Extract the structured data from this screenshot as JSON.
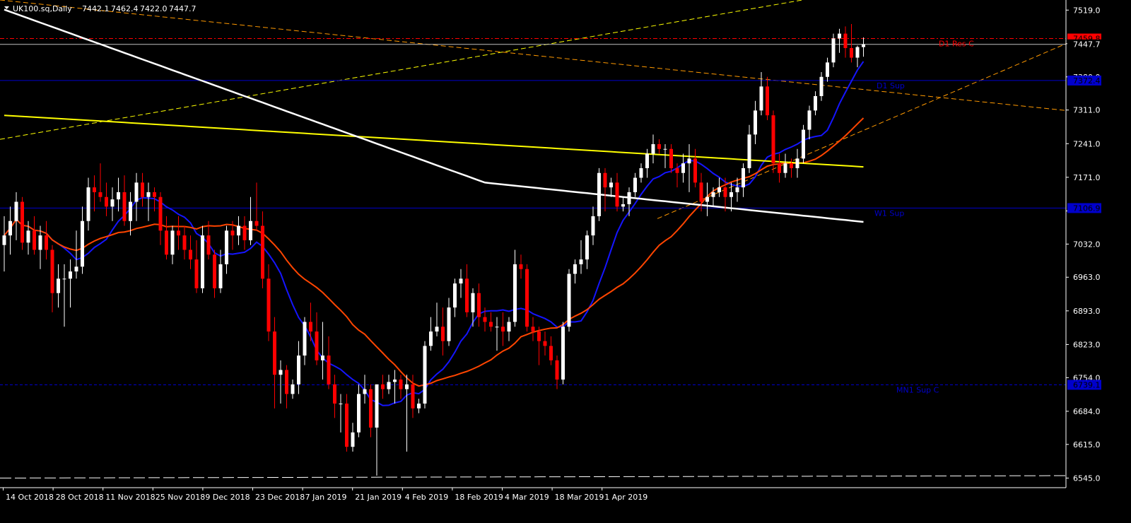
{
  "chart_data": {
    "type": "candlestick",
    "title": "UK100.sq,Daily",
    "ohlc_header": [
      "7442.1",
      "7462.4",
      "7422.0",
      "7447.7"
    ],
    "ylim": [
      6525,
      7540
    ],
    "y_ticks": [
      7519.0,
      7449.0,
      7380.0,
      7311.0,
      7241.0,
      7171.0,
      7101.0,
      7032.0,
      6963.0,
      6893.0,
      6823.0,
      6754.0,
      6684.0,
      6615.0,
      6545.0
    ],
    "y_tick_labels": [
      "7519.0",
      "",
      "7380.0",
      "7311.0",
      "7241.0",
      "7171.0",
      "",
      "7032.0",
      "6963.0",
      "6893.0",
      "6823.0",
      "6754.0",
      "6684.0",
      "6615.0",
      "6545.0"
    ],
    "x_tick_labels": [
      "14 Oct 2018",
      "28 Oct 2018",
      "11 Nov 2018",
      "25 Nov 2018",
      "9 Dec 2018",
      "23 Dec 2018",
      "7 Jan 2019",
      "21 Jan 2019",
      "4 Feb 2019",
      "18 Feb 2019",
      "4 Mar 2019",
      "18 Mar 2019",
      "1 Apr 2019"
    ],
    "grid": false,
    "colors": {
      "background": "#000000",
      "bull": "#ffffff",
      "bear": "#ff0000",
      "axis_text": "#ffffff",
      "ma_fast": "#1515ff",
      "ma_mid": "#ff4500",
      "ma_slow_yellow": "#ffff00",
      "ma_slow_white": "#ffffff",
      "level_blue": "#0000cc",
      "level_red": "#ff0000",
      "trend_orange": "#ff9900",
      "trend_yellow": "#ffff00"
    },
    "levels": [
      {
        "name": "D1 Res C",
        "price": 7459.8,
        "label": "7459.8",
        "style": "dashdot",
        "color": "#ff0000"
      },
      {
        "name": "current",
        "price": 7447.7,
        "label": "7447.7",
        "style": "solid",
        "color": "#c0c0c0"
      },
      {
        "name": "D1 Sup",
        "price": 7372.4,
        "label": "7372.4",
        "style": "solid",
        "color": "#0000cc"
      },
      {
        "name": "W1 Sup",
        "price": 7106.9,
        "label": "7106.9",
        "style": "solid",
        "color": "#0000cc"
      },
      {
        "name": "MN1 Sup C",
        "price": 6739.1,
        "label": "6739.1",
        "style": "dashed",
        "color": "#0000cc"
      }
    ],
    "candles": [
      {
        "date": "2018-10-11",
        "o": 7030,
        "h": 7090,
        "l": 6975,
        "c": 7050
      },
      {
        "date": "2018-10-12",
        "o": 7050,
        "h": 7110,
        "l": 7010,
        "c": 7080
      },
      {
        "date": "2018-10-15",
        "o": 7080,
        "h": 7140,
        "l": 7040,
        "c": 7120
      },
      {
        "date": "2018-10-16",
        "o": 7120,
        "h": 7130,
        "l": 7020,
        "c": 7035
      },
      {
        "date": "2018-10-17",
        "o": 7035,
        "h": 7080,
        "l": 7010,
        "c": 7060
      },
      {
        "date": "2018-10-18",
        "o": 7060,
        "h": 7090,
        "l": 7010,
        "c": 7020
      },
      {
        "date": "2018-10-19",
        "o": 7020,
        "h": 7070,
        "l": 6980,
        "c": 7050
      },
      {
        "date": "2018-10-22",
        "o": 7050,
        "h": 7080,
        "l": 7000,
        "c": 7020
      },
      {
        "date": "2018-10-23",
        "o": 7020,
        "h": 7030,
        "l": 6890,
        "c": 6930
      },
      {
        "date": "2018-10-24",
        "o": 6930,
        "h": 6990,
        "l": 6900,
        "c": 6960
      },
      {
        "date": "2018-10-25",
        "o": 6960,
        "h": 6990,
        "l": 6860,
        "c": 6960
      },
      {
        "date": "2018-10-26",
        "o": 6960,
        "h": 7000,
        "l": 6900,
        "c": 6975
      },
      {
        "date": "2018-10-29",
        "o": 6975,
        "h": 7060,
        "l": 6960,
        "c": 6985
      },
      {
        "date": "2018-10-30",
        "o": 6985,
        "h": 7110,
        "l": 6970,
        "c": 7080
      },
      {
        "date": "2018-10-31",
        "o": 7080,
        "h": 7170,
        "l": 7060,
        "c": 7150
      },
      {
        "date": "2018-11-01",
        "o": 7150,
        "h": 7175,
        "l": 7100,
        "c": 7140
      },
      {
        "date": "2018-11-02",
        "o": 7140,
        "h": 7200,
        "l": 7120,
        "c": 7130
      },
      {
        "date": "2018-11-05",
        "o": 7130,
        "h": 7160,
        "l": 7090,
        "c": 7110
      },
      {
        "date": "2018-11-06",
        "o": 7110,
        "h": 7150,
        "l": 7080,
        "c": 7125
      },
      {
        "date": "2018-11-07",
        "o": 7125,
        "h": 7170,
        "l": 7100,
        "c": 7140
      },
      {
        "date": "2018-11-08",
        "o": 7140,
        "h": 7175,
        "l": 7070,
        "c": 7080
      },
      {
        "date": "2018-11-09",
        "o": 7080,
        "h": 7140,
        "l": 7050,
        "c": 7120
      },
      {
        "date": "2018-11-12",
        "o": 7120,
        "h": 7180,
        "l": 7080,
        "c": 7160
      },
      {
        "date": "2018-11-13",
        "o": 7160,
        "h": 7180,
        "l": 7110,
        "c": 7130
      },
      {
        "date": "2018-11-14",
        "o": 7130,
        "h": 7160,
        "l": 7080,
        "c": 7140
      },
      {
        "date": "2018-11-15",
        "o": 7140,
        "h": 7150,
        "l": 7100,
        "c": 7130
      },
      {
        "date": "2018-11-16",
        "o": 7130,
        "h": 7140,
        "l": 7030,
        "c": 7060
      },
      {
        "date": "2018-11-19",
        "o": 7060,
        "h": 7090,
        "l": 7000,
        "c": 7010
      },
      {
        "date": "2018-11-20",
        "o": 7010,
        "h": 7070,
        "l": 6990,
        "c": 7060
      },
      {
        "date": "2018-11-21",
        "o": 7060,
        "h": 7090,
        "l": 7020,
        "c": 7050
      },
      {
        "date": "2018-11-22",
        "o": 7050,
        "h": 7070,
        "l": 7000,
        "c": 7020
      },
      {
        "date": "2018-11-23",
        "o": 7020,
        "h": 7050,
        "l": 6980,
        "c": 7000
      },
      {
        "date": "2018-11-26",
        "o": 7000,
        "h": 7040,
        "l": 6930,
        "c": 6940
      },
      {
        "date": "2018-11-27",
        "o": 6940,
        "h": 7070,
        "l": 6930,
        "c": 7050
      },
      {
        "date": "2018-11-28",
        "o": 7050,
        "h": 7080,
        "l": 7000,
        "c": 7010
      },
      {
        "date": "2018-11-29",
        "o": 7010,
        "h": 7020,
        "l": 6920,
        "c": 6940
      },
      {
        "date": "2018-11-30",
        "o": 6940,
        "h": 7020,
        "l": 6930,
        "c": 6990
      },
      {
        "date": "2018-12-03",
        "o": 6990,
        "h": 7070,
        "l": 6970,
        "c": 7060
      },
      {
        "date": "2018-12-04",
        "o": 7060,
        "h": 7080,
        "l": 7020,
        "c": 7050
      },
      {
        "date": "2018-12-05",
        "o": 7050,
        "h": 7090,
        "l": 7030,
        "c": 7070
      },
      {
        "date": "2018-12-06",
        "o": 7070,
        "h": 7090,
        "l": 7020,
        "c": 7040
      },
      {
        "date": "2018-12-07",
        "o": 7040,
        "h": 7130,
        "l": 7030,
        "c": 7080
      },
      {
        "date": "2018-12-10",
        "o": 7080,
        "h": 7160,
        "l": 7060,
        "c": 7070
      },
      {
        "date": "2018-12-11",
        "o": 7070,
        "h": 7100,
        "l": 6940,
        "c": 6960
      },
      {
        "date": "2018-12-12",
        "o": 6960,
        "h": 6990,
        "l": 6830,
        "c": 6850
      },
      {
        "date": "2018-12-13",
        "o": 6850,
        "h": 6880,
        "l": 6690,
        "c": 6760
      },
      {
        "date": "2018-12-14",
        "o": 6760,
        "h": 6790,
        "l": 6700,
        "c": 6770
      },
      {
        "date": "2018-12-17",
        "o": 6770,
        "h": 6780,
        "l": 6690,
        "c": 6720
      },
      {
        "date": "2018-12-18",
        "o": 6720,
        "h": 6750,
        "l": 6710,
        "c": 6740
      },
      {
        "date": "2018-12-19",
        "o": 6740,
        "h": 6830,
        "l": 6720,
        "c": 6800
      },
      {
        "date": "2018-12-20",
        "o": 6800,
        "h": 6880,
        "l": 6780,
        "c": 6870
      },
      {
        "date": "2018-12-21",
        "o": 6870,
        "h": 6910,
        "l": 6830,
        "c": 6850
      },
      {
        "date": "2018-12-24",
        "o": 6850,
        "h": 6890,
        "l": 6780,
        "c": 6790
      },
      {
        "date": "2018-12-27",
        "o": 6790,
        "h": 6870,
        "l": 6750,
        "c": 6800
      },
      {
        "date": "2018-12-28",
        "o": 6800,
        "h": 6840,
        "l": 6730,
        "c": 6740
      },
      {
        "date": "2018-12-31",
        "o": 6740,
        "h": 6760,
        "l": 6670,
        "c": 6700
      },
      {
        "date": "2019-01-02",
        "o": 6700,
        "h": 6720,
        "l": 6640,
        "c": 6700
      },
      {
        "date": "2019-01-03",
        "o": 6700,
        "h": 6720,
        "l": 6600,
        "c": 6610
      },
      {
        "date": "2019-01-04",
        "o": 6610,
        "h": 6660,
        "l": 6600,
        "c": 6640
      },
      {
        "date": "2019-01-07",
        "o": 6640,
        "h": 6740,
        "l": 6630,
        "c": 6720
      },
      {
        "date": "2019-01-08",
        "o": 6720,
        "h": 6760,
        "l": 6700,
        "c": 6730
      },
      {
        "date": "2019-01-09",
        "o": 6730,
        "h": 6740,
        "l": 6630,
        "c": 6650
      },
      {
        "date": "2019-01-10",
        "o": 6650,
        "h": 6740,
        "l": 6550,
        "c": 6740
      },
      {
        "date": "2019-01-11",
        "o": 6740,
        "h": 6760,
        "l": 6710,
        "c": 6730
      },
      {
        "date": "2019-01-14",
        "o": 6730,
        "h": 6760,
        "l": 6720,
        "c": 6745
      },
      {
        "date": "2019-01-15",
        "o": 6745,
        "h": 6770,
        "l": 6700,
        "c": 6750
      },
      {
        "date": "2019-01-16",
        "o": 6750,
        "h": 6760,
        "l": 6710,
        "c": 6730
      },
      {
        "date": "2019-01-17",
        "o": 6730,
        "h": 6760,
        "l": 6600,
        "c": 6740
      },
      {
        "date": "2019-01-18",
        "o": 6740,
        "h": 6760,
        "l": 6670,
        "c": 6690
      },
      {
        "date": "2019-01-21",
        "o": 6690,
        "h": 6710,
        "l": 6680,
        "c": 6700
      },
      {
        "date": "2019-01-22",
        "o": 6700,
        "h": 6830,
        "l": 6690,
        "c": 6820
      },
      {
        "date": "2019-01-23",
        "o": 6820,
        "h": 6880,
        "l": 6810,
        "c": 6850
      },
      {
        "date": "2019-01-24",
        "o": 6850,
        "h": 6910,
        "l": 6840,
        "c": 6860
      },
      {
        "date": "2019-01-25",
        "o": 6860,
        "h": 6900,
        "l": 6800,
        "c": 6830
      },
      {
        "date": "2019-01-28",
        "o": 6830,
        "h": 6920,
        "l": 6820,
        "c": 6900
      },
      {
        "date": "2019-01-29",
        "o": 6900,
        "h": 6960,
        "l": 6880,
        "c": 6950
      },
      {
        "date": "2019-01-30",
        "o": 6950,
        "h": 6980,
        "l": 6920,
        "c": 6960
      },
      {
        "date": "2019-01-31",
        "o": 6960,
        "h": 6990,
        "l": 6880,
        "c": 6890
      },
      {
        "date": "2019-02-01",
        "o": 6890,
        "h": 6940,
        "l": 6860,
        "c": 6930
      },
      {
        "date": "2019-02-04",
        "o": 6930,
        "h": 6950,
        "l": 6860,
        "c": 6880
      },
      {
        "date": "2019-02-05",
        "o": 6880,
        "h": 6900,
        "l": 6850,
        "c": 6870
      },
      {
        "date": "2019-02-06",
        "o": 6870,
        "h": 6890,
        "l": 6850,
        "c": 6860
      },
      {
        "date": "2019-02-07",
        "o": 6860,
        "h": 6880,
        "l": 6810,
        "c": 6860
      },
      {
        "date": "2019-02-08",
        "o": 6860,
        "h": 6890,
        "l": 6820,
        "c": 6850
      },
      {
        "date": "2019-02-11",
        "o": 6850,
        "h": 6880,
        "l": 6830,
        "c": 6870
      },
      {
        "date": "2019-02-12",
        "o": 6870,
        "h": 7020,
        "l": 6860,
        "c": 6990
      },
      {
        "date": "2019-02-13",
        "o": 6990,
        "h": 7010,
        "l": 6960,
        "c": 6980
      },
      {
        "date": "2019-02-14",
        "o": 6980,
        "h": 6990,
        "l": 6850,
        "c": 6860
      },
      {
        "date": "2019-02-15",
        "o": 6860,
        "h": 6880,
        "l": 6830,
        "c": 6850
      },
      {
        "date": "2019-02-18",
        "o": 6850,
        "h": 6860,
        "l": 6780,
        "c": 6830
      },
      {
        "date": "2019-02-19",
        "o": 6830,
        "h": 6850,
        "l": 6800,
        "c": 6820
      },
      {
        "date": "2019-02-20",
        "o": 6820,
        "h": 6840,
        "l": 6780,
        "c": 6790
      },
      {
        "date": "2019-02-21",
        "o": 6790,
        "h": 6800,
        "l": 6730,
        "c": 6750
      },
      {
        "date": "2019-02-22",
        "o": 6750,
        "h": 6870,
        "l": 6740,
        "c": 6860
      },
      {
        "date": "2019-02-25",
        "o": 6860,
        "h": 6980,
        "l": 6850,
        "c": 6970
      },
      {
        "date": "2019-02-26",
        "o": 6970,
        "h": 7000,
        "l": 6950,
        "c": 6990
      },
      {
        "date": "2019-02-27",
        "o": 6990,
        "h": 7040,
        "l": 6970,
        "c": 7000
      },
      {
        "date": "2019-02-28",
        "o": 7000,
        "h": 7060,
        "l": 6980,
        "c": 7050
      },
      {
        "date": "2019-03-01",
        "o": 7050,
        "h": 7110,
        "l": 7030,
        "c": 7090
      },
      {
        "date": "2019-03-04",
        "o": 7090,
        "h": 7190,
        "l": 7080,
        "c": 7180
      },
      {
        "date": "2019-03-05",
        "o": 7180,
        "h": 7190,
        "l": 7100,
        "c": 7150
      },
      {
        "date": "2019-03-06",
        "o": 7150,
        "h": 7170,
        "l": 7130,
        "c": 7160
      },
      {
        "date": "2019-03-07",
        "o": 7160,
        "h": 7180,
        "l": 7100,
        "c": 7110
      },
      {
        "date": "2019-03-08",
        "o": 7110,
        "h": 7130,
        "l": 7100,
        "c": 7115
      },
      {
        "date": "2019-03-11",
        "o": 7115,
        "h": 7150,
        "l": 7090,
        "c": 7140
      },
      {
        "date": "2019-03-12",
        "o": 7140,
        "h": 7180,
        "l": 7130,
        "c": 7170
      },
      {
        "date": "2019-03-13",
        "o": 7170,
        "h": 7200,
        "l": 7160,
        "c": 7190
      },
      {
        "date": "2019-03-14",
        "o": 7190,
        "h": 7230,
        "l": 7170,
        "c": 7220
      },
      {
        "date": "2019-03-15",
        "o": 7220,
        "h": 7260,
        "l": 7200,
        "c": 7240
      },
      {
        "date": "2019-03-18",
        "o": 7240,
        "h": 7250,
        "l": 7220,
        "c": 7230
      },
      {
        "date": "2019-03-19",
        "o": 7230,
        "h": 7240,
        "l": 7190,
        "c": 7230
      },
      {
        "date": "2019-03-20",
        "o": 7230,
        "h": 7240,
        "l": 7180,
        "c": 7190
      },
      {
        "date": "2019-03-21",
        "o": 7190,
        "h": 7200,
        "l": 7150,
        "c": 7180
      },
      {
        "date": "2019-03-22",
        "o": 7180,
        "h": 7220,
        "l": 7160,
        "c": 7200
      },
      {
        "date": "2019-03-25",
        "o": 7200,
        "h": 7240,
        "l": 7140,
        "c": 7210
      },
      {
        "date": "2019-03-26",
        "o": 7210,
        "h": 7230,
        "l": 7150,
        "c": 7160
      },
      {
        "date": "2019-03-27",
        "o": 7160,
        "h": 7180,
        "l": 7100,
        "c": 7120
      },
      {
        "date": "2019-03-28",
        "o": 7120,
        "h": 7160,
        "l": 7090,
        "c": 7130
      },
      {
        "date": "2019-03-29",
        "o": 7130,
        "h": 7150,
        "l": 7110,
        "c": 7140
      },
      {
        "date": "2019-04-01",
        "o": 7140,
        "h": 7170,
        "l": 7130,
        "c": 7150
      },
      {
        "date": "2019-04-02",
        "o": 7150,
        "h": 7170,
        "l": 7100,
        "c": 7130
      },
      {
        "date": "2019-04-03",
        "o": 7130,
        "h": 7160,
        "l": 7100,
        "c": 7140
      },
      {
        "date": "2019-04-04",
        "o": 7140,
        "h": 7170,
        "l": 7120,
        "c": 7150
      },
      {
        "date": "2019-04-05",
        "o": 7150,
        "h": 7200,
        "l": 7130,
        "c": 7190
      },
      {
        "date": "2019-04-08",
        "o": 7190,
        "h": 7280,
        "l": 7180,
        "c": 7260
      },
      {
        "date": "2019-04-09",
        "o": 7260,
        "h": 7330,
        "l": 7240,
        "c": 7310
      },
      {
        "date": "2019-04-10",
        "o": 7310,
        "h": 7390,
        "l": 7300,
        "c": 7360
      },
      {
        "date": "2019-04-11",
        "o": 7360,
        "h": 7380,
        "l": 7290,
        "c": 7300
      },
      {
        "date": "2019-04-12",
        "o": 7300,
        "h": 7310,
        "l": 7180,
        "c": 7200
      },
      {
        "date": "2019-04-15",
        "o": 7200,
        "h": 7220,
        "l": 7160,
        "c": 7180
      },
      {
        "date": "2019-04-16",
        "o": 7180,
        "h": 7220,
        "l": 7170,
        "c": 7200
      },
      {
        "date": "2019-04-17",
        "o": 7200,
        "h": 7210,
        "l": 7170,
        "c": 7190
      },
      {
        "date": "2019-04-18",
        "o": 7190,
        "h": 7230,
        "l": 7170,
        "c": 7210
      },
      {
        "date": "2019-04-19",
        "o": 7210,
        "h": 7280,
        "l": 7200,
        "c": 7270
      },
      {
        "date": "2019-04-22",
        "o": 7270,
        "h": 7320,
        "l": 7250,
        "c": 7310
      },
      {
        "date": "2019-04-23",
        "o": 7310,
        "h": 7350,
        "l": 7300,
        "c": 7340
      },
      {
        "date": "2019-04-24",
        "o": 7340,
        "h": 7390,
        "l": 7330,
        "c": 7380
      },
      {
        "date": "2019-04-25",
        "o": 7380,
        "h": 7420,
        "l": 7370,
        "c": 7410
      },
      {
        "date": "2019-04-26",
        "o": 7410,
        "h": 7470,
        "l": 7400,
        "c": 7460
      },
      {
        "date": "2019-04-29",
        "o": 7460,
        "h": 7480,
        "l": 7430,
        "c": 7470
      },
      {
        "date": "2019-04-30",
        "o": 7470,
        "h": 7485,
        "l": 7420,
        "c": 7440
      },
      {
        "date": "2019-05-01",
        "o": 7440,
        "h": 7490,
        "l": 7410,
        "c": 7420
      },
      {
        "date": "2019-05-02",
        "o": 7420,
        "h": 7445,
        "l": 7400,
        "c": 7442
      },
      {
        "date": "2019-05-03",
        "o": 7442,
        "h": 7462,
        "l": 7422,
        "c": 7447.7
      }
    ]
  }
}
